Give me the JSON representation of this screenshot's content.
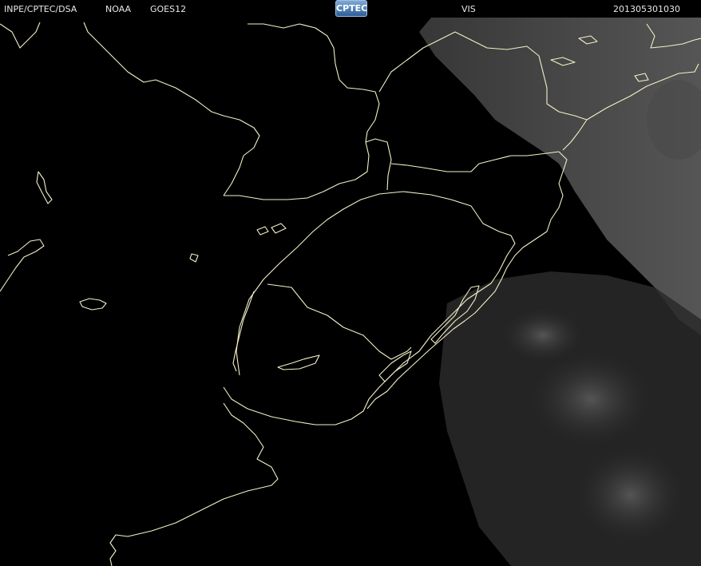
{
  "header": {
    "source": "INPE/CPTEC/DSA",
    "agency": "NOAA",
    "satellite": "GOES12",
    "logo_text": "CPTEC",
    "channel": "VIS",
    "timestamp": "201305301030"
  },
  "colors": {
    "background": "#000000",
    "border_lines": "#f4f0c8",
    "header_text": "#e8e8e8",
    "cloud_gray": "#555555"
  }
}
